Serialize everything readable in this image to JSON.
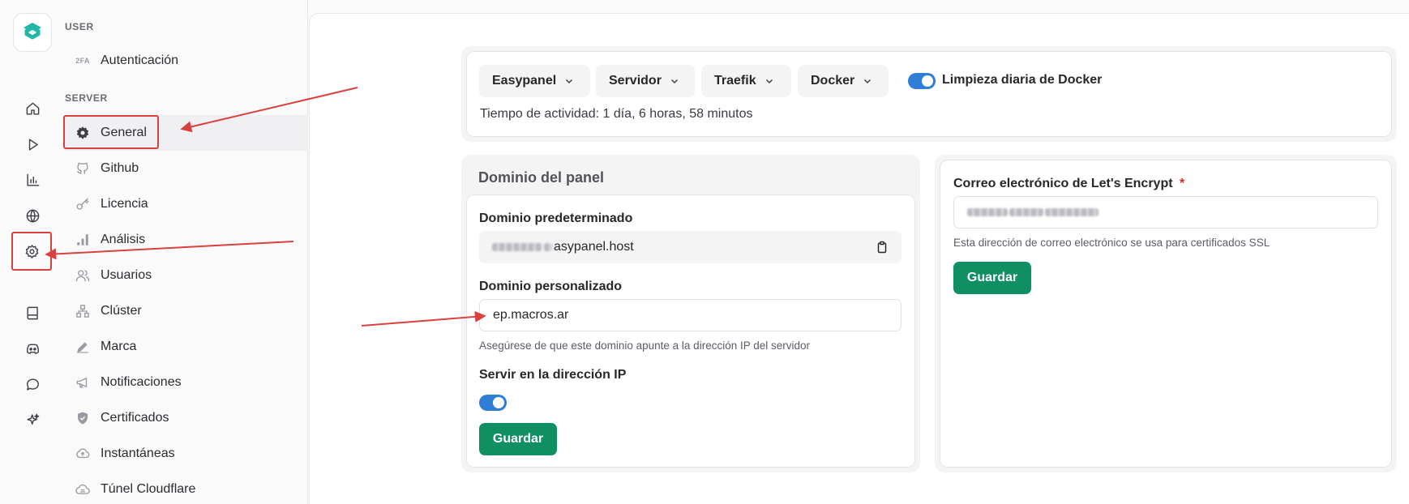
{
  "sidebar": {
    "user_section": "USER",
    "server_section": "SERVER",
    "auth_badge": "2FA",
    "items": [
      {
        "label": "Autenticación"
      },
      {
        "label": "General"
      },
      {
        "label": "Github"
      },
      {
        "label": "Licencia"
      },
      {
        "label": "Análisis"
      },
      {
        "label": "Usuarios"
      },
      {
        "label": "Clúster"
      },
      {
        "label": "Marca"
      },
      {
        "label": "Notificaciones"
      },
      {
        "label": "Certificados"
      },
      {
        "label": "Instantáneas"
      },
      {
        "label": "Túnel Cloudflare"
      }
    ]
  },
  "toolbar": {
    "menus": [
      "Easypanel",
      "Servidor",
      "Traefik",
      "Docker"
    ],
    "cleanup_label": "Limpieza diaria de Docker",
    "cleanup_enabled": true,
    "uptime": "Tiempo de actividad: 1 día, 6 horas, 58 minutos"
  },
  "panel_domain": {
    "title": "Dominio del panel",
    "default_label": "Dominio predeterminado",
    "default_value_suffix": "asypanel.host",
    "custom_label": "Dominio personalizado",
    "custom_value": "ep.macros.ar",
    "custom_hint": "Asegúrese de que este dominio apunte a la dirección IP del servidor",
    "serve_ip_label": "Servir en la dirección IP",
    "serve_ip_enabled": true,
    "save_label": "Guardar"
  },
  "letsencrypt": {
    "label": "Correo electrónico de Let's Encrypt",
    "required_mark": "*",
    "hint": "Esta dirección de correo electrónico se usa para certificados SSL",
    "save_label": "Guardar"
  },
  "colors": {
    "accent_green": "#0f8f62",
    "toggle_blue": "#2e7dd6",
    "annotation_red": "#d9413f"
  }
}
